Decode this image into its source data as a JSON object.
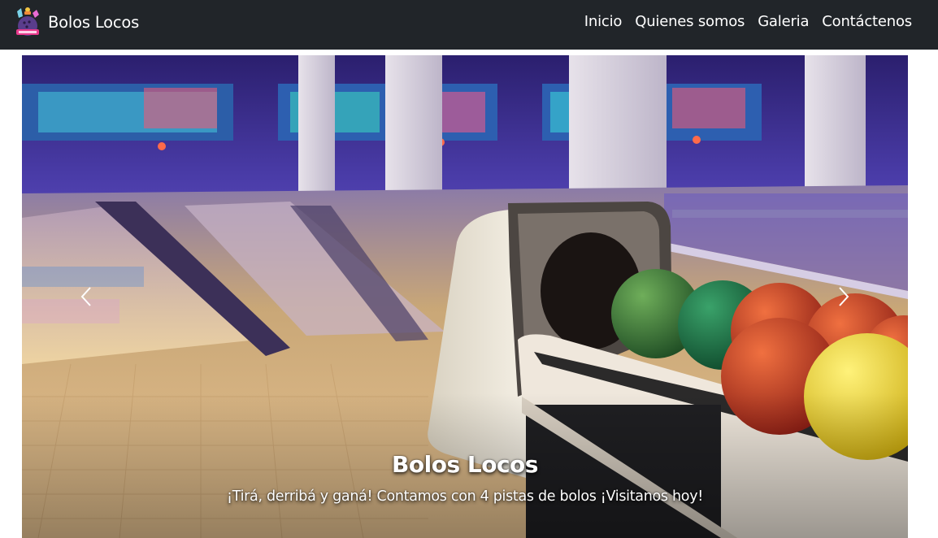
{
  "navbar": {
    "brand": "Bolos Locos",
    "logo_icon": "bowling-logo-icon",
    "links": [
      {
        "label": "Inicio"
      },
      {
        "label": "Quienes somos"
      },
      {
        "label": "Galeria"
      },
      {
        "label": "Contáctenos"
      }
    ]
  },
  "carousel": {
    "slide_image": "bowling-alley-photo",
    "prev_icon": "chevron-left-icon",
    "next_icon": "chevron-right-icon",
    "caption": {
      "title": "Bolos Locos",
      "text": "¡Tirá, derribá y ganá! Contamos con 4 pistas de bolos ¡Visitanos hoy!"
    }
  },
  "colors": {
    "navbar_bg": "#212529",
    "nav_text": "#ffffff",
    "ball_green": "#2d7a3a",
    "ball_red": "#c23a2a",
    "ball_yellow": "#e8cf1c"
  }
}
